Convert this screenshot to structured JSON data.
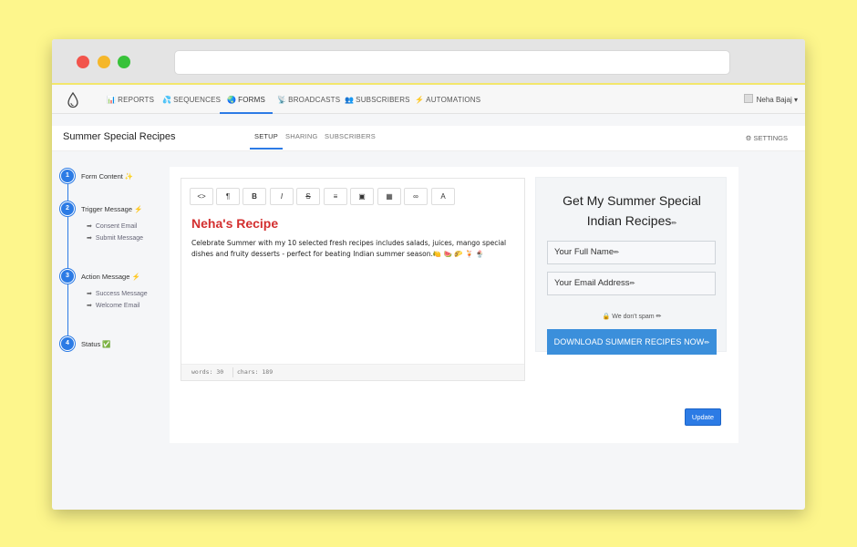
{
  "nav": {
    "items": [
      {
        "icon": "📊",
        "label": "REPORTS"
      },
      {
        "icon": "💦",
        "label": "SEQUENCES"
      },
      {
        "icon": "🌏",
        "label": "FORMS"
      },
      {
        "icon": "📡",
        "label": "BROADCASTS"
      },
      {
        "icon": "👥",
        "label": "SUBSCRIBERS"
      },
      {
        "icon": "⚡",
        "label": "AUTOMATIONS"
      }
    ],
    "active": "FORMS",
    "user": "Neha Bajaj"
  },
  "page": {
    "title": "Summer Special Recipes",
    "tabs": [
      "SETUP",
      "SHARING",
      "SUBSCRIBERS"
    ],
    "settings_label": "SETTINGS"
  },
  "steps": [
    {
      "number": "1",
      "label": "Form Content ✨",
      "subs": []
    },
    {
      "number": "2",
      "label": "Trigger Message ⚡",
      "subs": [
        "Consent Email",
        "Submit Message"
      ]
    },
    {
      "number": "3",
      "label": "Action Message ⚡",
      "subs": [
        "Success Message",
        "Welcome Email"
      ]
    },
    {
      "number": "4",
      "label": "Status ✅",
      "subs": []
    }
  ],
  "editor": {
    "toolbar": [
      "<>",
      "¶",
      "B",
      "I",
      "S",
      "≡",
      "▣",
      "▦",
      "∞",
      "A"
    ],
    "heading": "Neha's Recipe",
    "body": "Celebrate Summer with my 10 selected fresh recipes includes salads, juices, mango special dishes and fruity desserts - perfect for beating Indian summer season.🍋 🍉 🌮 🍹 🍨",
    "words": "words: 30",
    "chars": "chars: 189"
  },
  "preview": {
    "title_line1": "Get My Summer Special",
    "title_line2": "Indian Recipes",
    "name_placeholder": "Your Full Name",
    "email_placeholder": "Your Email Address",
    "spam_text": "We don't spam",
    "button_label": "DOWNLOAD SUMMER RECIPES NOW"
  },
  "update_label": "Update",
  "colors": {
    "accent": "#2c7be5",
    "heading_red": "#d32f2f",
    "button_blue": "#3b8fdb",
    "desktop_yellow": "#fdf68c"
  }
}
